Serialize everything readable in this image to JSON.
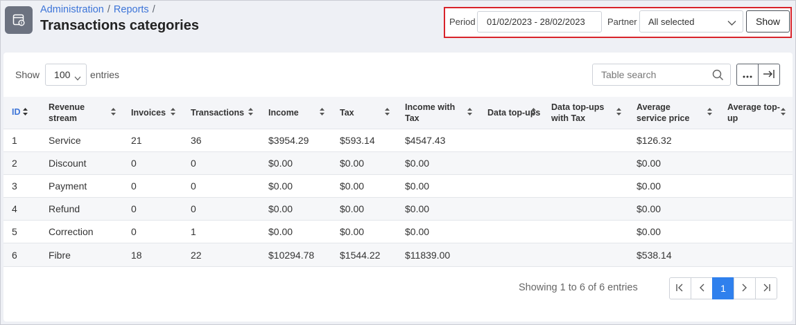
{
  "breadcrumb": [
    {
      "label": "Administration"
    },
    {
      "label": "Reports"
    }
  ],
  "breadcrumb_sep": "/",
  "page_title": "Transactions categories",
  "filters": {
    "period_label": "Period",
    "period_value": "01/02/2023 - 28/02/2023",
    "partner_label": "Partner",
    "partner_value": "All selected",
    "show_label": "Show"
  },
  "length": {
    "show_text": "Show",
    "value": "100",
    "entries_text": "entries"
  },
  "search": {
    "placeholder": "Table search"
  },
  "table": {
    "columns": [
      "ID",
      "Revenue stream",
      "Invoices",
      "Transactions",
      "Income",
      "Tax",
      "Income with Tax",
      "Data top-ups",
      "Data top-ups with Tax",
      "Average service price",
      "Average top-up"
    ],
    "rows": [
      [
        "1",
        "Service",
        "21",
        "36",
        "$3954.29",
        "$593.14",
        "$4547.43",
        "",
        "",
        "$126.32",
        ""
      ],
      [
        "2",
        "Discount",
        "0",
        "0",
        "$0.00",
        "$0.00",
        "$0.00",
        "",
        "",
        "$0.00",
        ""
      ],
      [
        "3",
        "Payment",
        "0",
        "0",
        "$0.00",
        "$0.00",
        "$0.00",
        "",
        "",
        "$0.00",
        ""
      ],
      [
        "4",
        "Refund",
        "0",
        "0",
        "$0.00",
        "$0.00",
        "$0.00",
        "",
        "",
        "$0.00",
        ""
      ],
      [
        "5",
        "Correction",
        "0",
        "1",
        "$0.00",
        "$0.00",
        "$0.00",
        "",
        "",
        "$0.00",
        ""
      ],
      [
        "6",
        "Fibre",
        "18",
        "22",
        "$10294.78",
        "$1544.22",
        "$11839.00",
        "",
        "",
        "$538.14",
        ""
      ]
    ]
  },
  "info_text": "Showing 1 to 6 of 6 entries",
  "pagination": {
    "current_page": "1"
  },
  "colors": {
    "accent": "#2f80ed",
    "link": "#3c74d8",
    "highlight_border": "#d8232a"
  },
  "icons": [
    "report-icon",
    "chevron-down-icon",
    "search-icon",
    "more-icon",
    "expand-icon",
    "first-page-icon",
    "prev-page-icon",
    "next-page-icon",
    "last-page-icon",
    "sort-icon"
  ]
}
